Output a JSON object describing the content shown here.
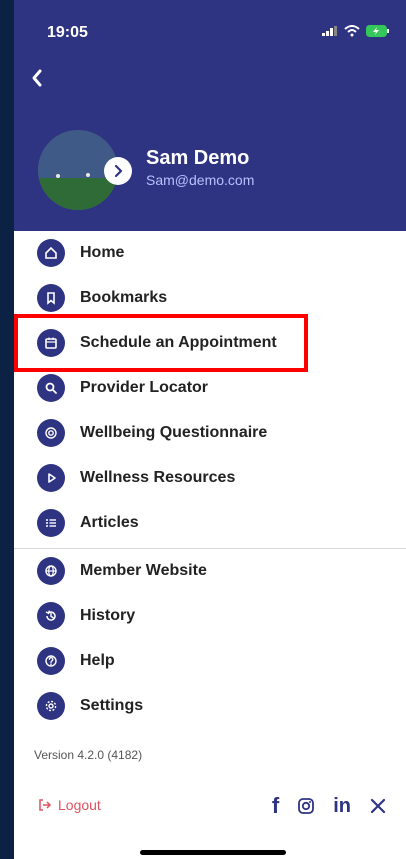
{
  "status_bar": {
    "time": "19:05"
  },
  "profile": {
    "name": "Sam Demo",
    "email": "Sam@demo.com"
  },
  "menu": {
    "items": [
      {
        "label": "Home",
        "icon": "home-icon"
      },
      {
        "label": "Bookmarks",
        "icon": "bookmark-icon"
      },
      {
        "label": "Schedule an Appointment",
        "icon": "calendar-icon"
      },
      {
        "label": "Provider Locator",
        "icon": "search-icon"
      },
      {
        "label": "Wellbeing Questionnaire",
        "icon": "questionnaire-icon"
      },
      {
        "label": "Wellness Resources",
        "icon": "play-icon"
      },
      {
        "label": "Articles",
        "icon": "list-icon"
      }
    ],
    "secondary_items": [
      {
        "label": "Member Website",
        "icon": "globe-icon"
      },
      {
        "label": "History",
        "icon": "history-icon"
      },
      {
        "label": "Help",
        "icon": "help-icon"
      },
      {
        "label": "Settings",
        "icon": "settings-icon"
      }
    ]
  },
  "footer": {
    "version": "Version 4.2.0 (4182)",
    "logout": "Logout"
  },
  "colors": {
    "primary": "#2e3482",
    "highlight": "#ff0000",
    "logout": "#e05260"
  }
}
